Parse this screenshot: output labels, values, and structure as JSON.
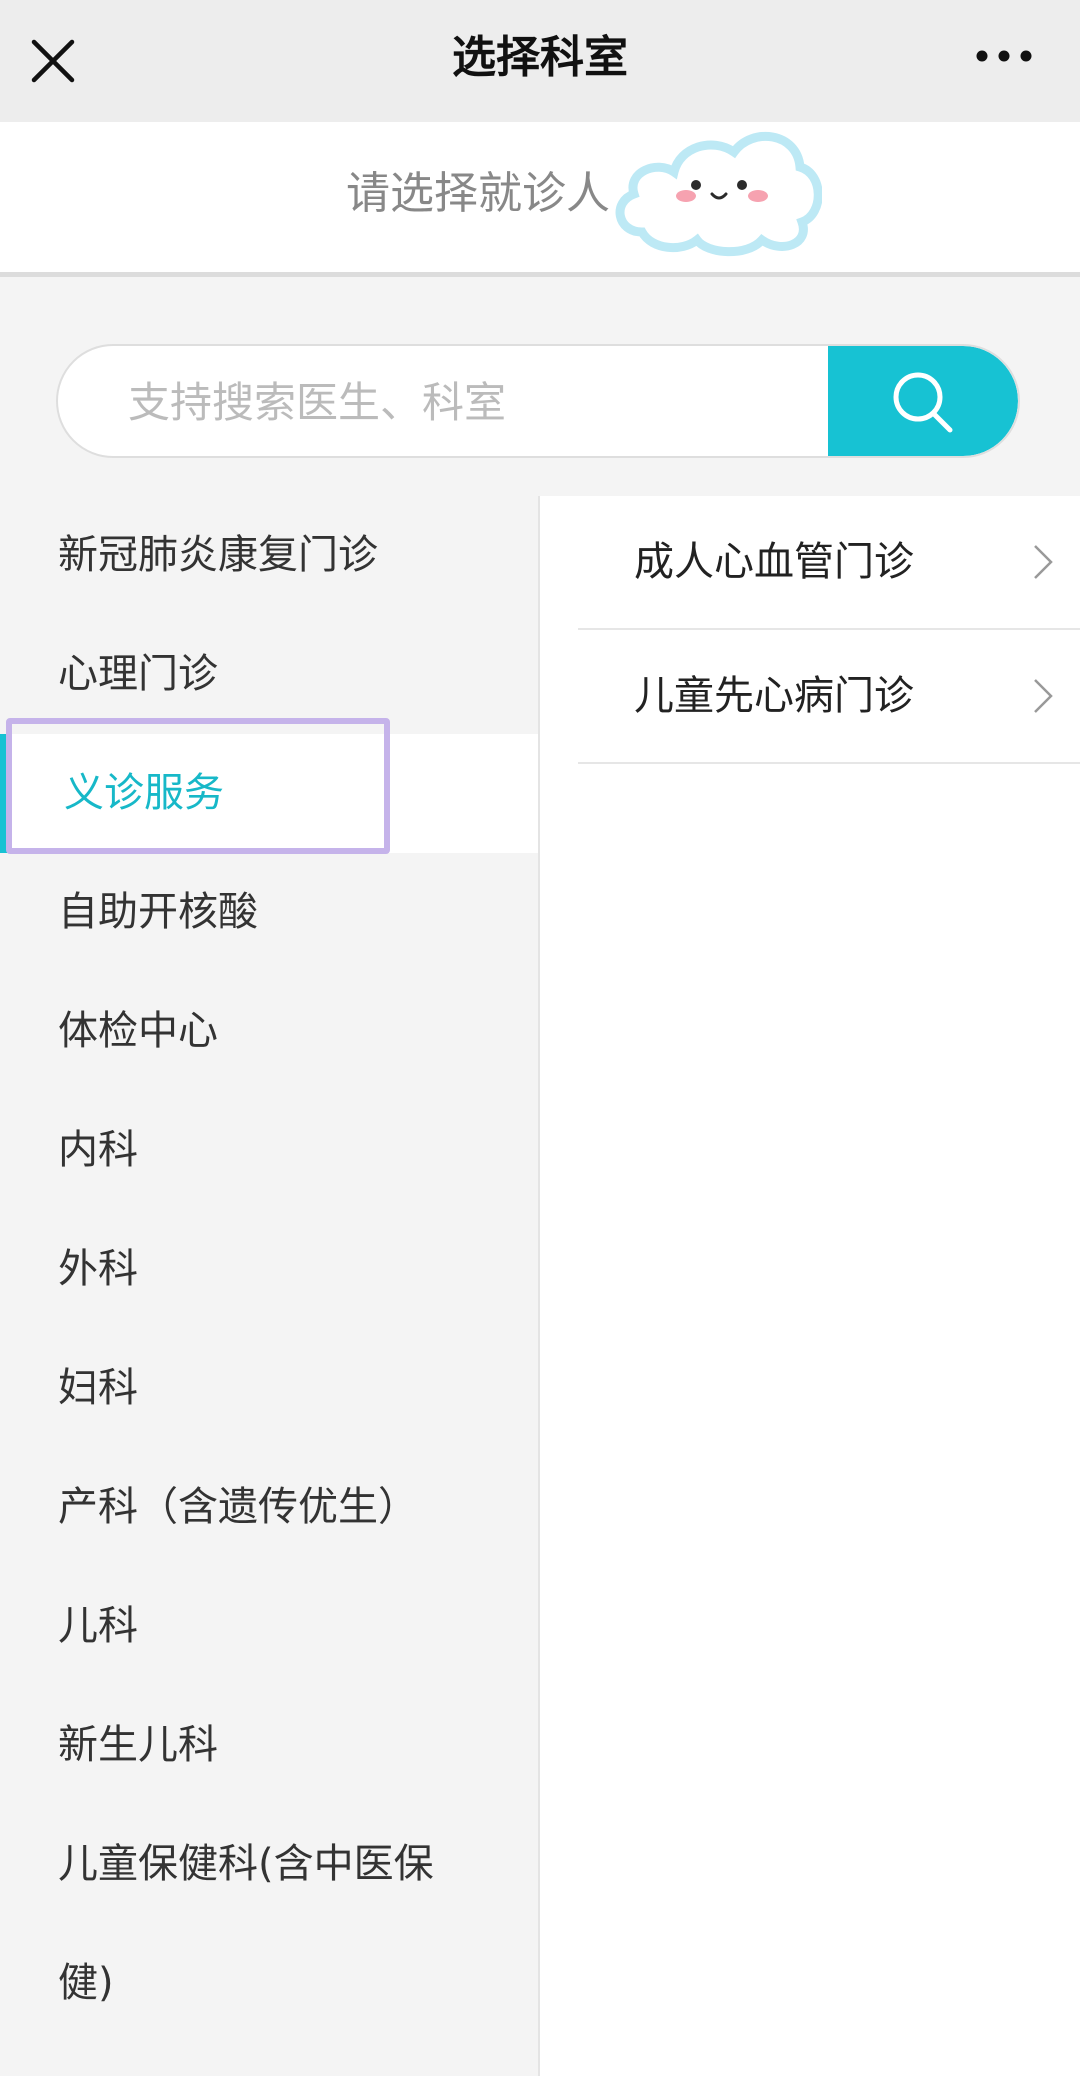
{
  "header": {
    "title": "选择科室",
    "close_icon": "close-icon",
    "more_icon": "more-dots-icon"
  },
  "patient": {
    "label": "请选择就诊人",
    "mascot_icon": "cloud-face-icon"
  },
  "search": {
    "placeholder": "支持搜索医生、科室",
    "value": "",
    "button_icon": "search-icon"
  },
  "departments": [
    {
      "label": "新冠肺炎康复门诊"
    },
    {
      "label": "心理门诊"
    },
    {
      "label": "义诊服务",
      "selected": true
    },
    {
      "label": "自助开核酸"
    },
    {
      "label": "体检中心"
    },
    {
      "label": "内科"
    },
    {
      "label": "外科"
    },
    {
      "label": "妇科"
    },
    {
      "label": "产科（含遗传优生）"
    },
    {
      "label": "儿科"
    },
    {
      "label": "新生儿科"
    },
    {
      "label_line1": "儿童保健科(含中医保",
      "label_line2": "健)"
    }
  ],
  "sub_departments": [
    {
      "label": "成人心血管门诊",
      "icon": "chevron-right-icon"
    },
    {
      "label": "儿童先心病门诊",
      "icon": "chevron-right-icon"
    }
  ],
  "colors": {
    "accent": "#17c2d3",
    "selection_outline": "#c5b3ea",
    "header_bg": "#ededed",
    "list_bg": "#f4f4f4"
  }
}
